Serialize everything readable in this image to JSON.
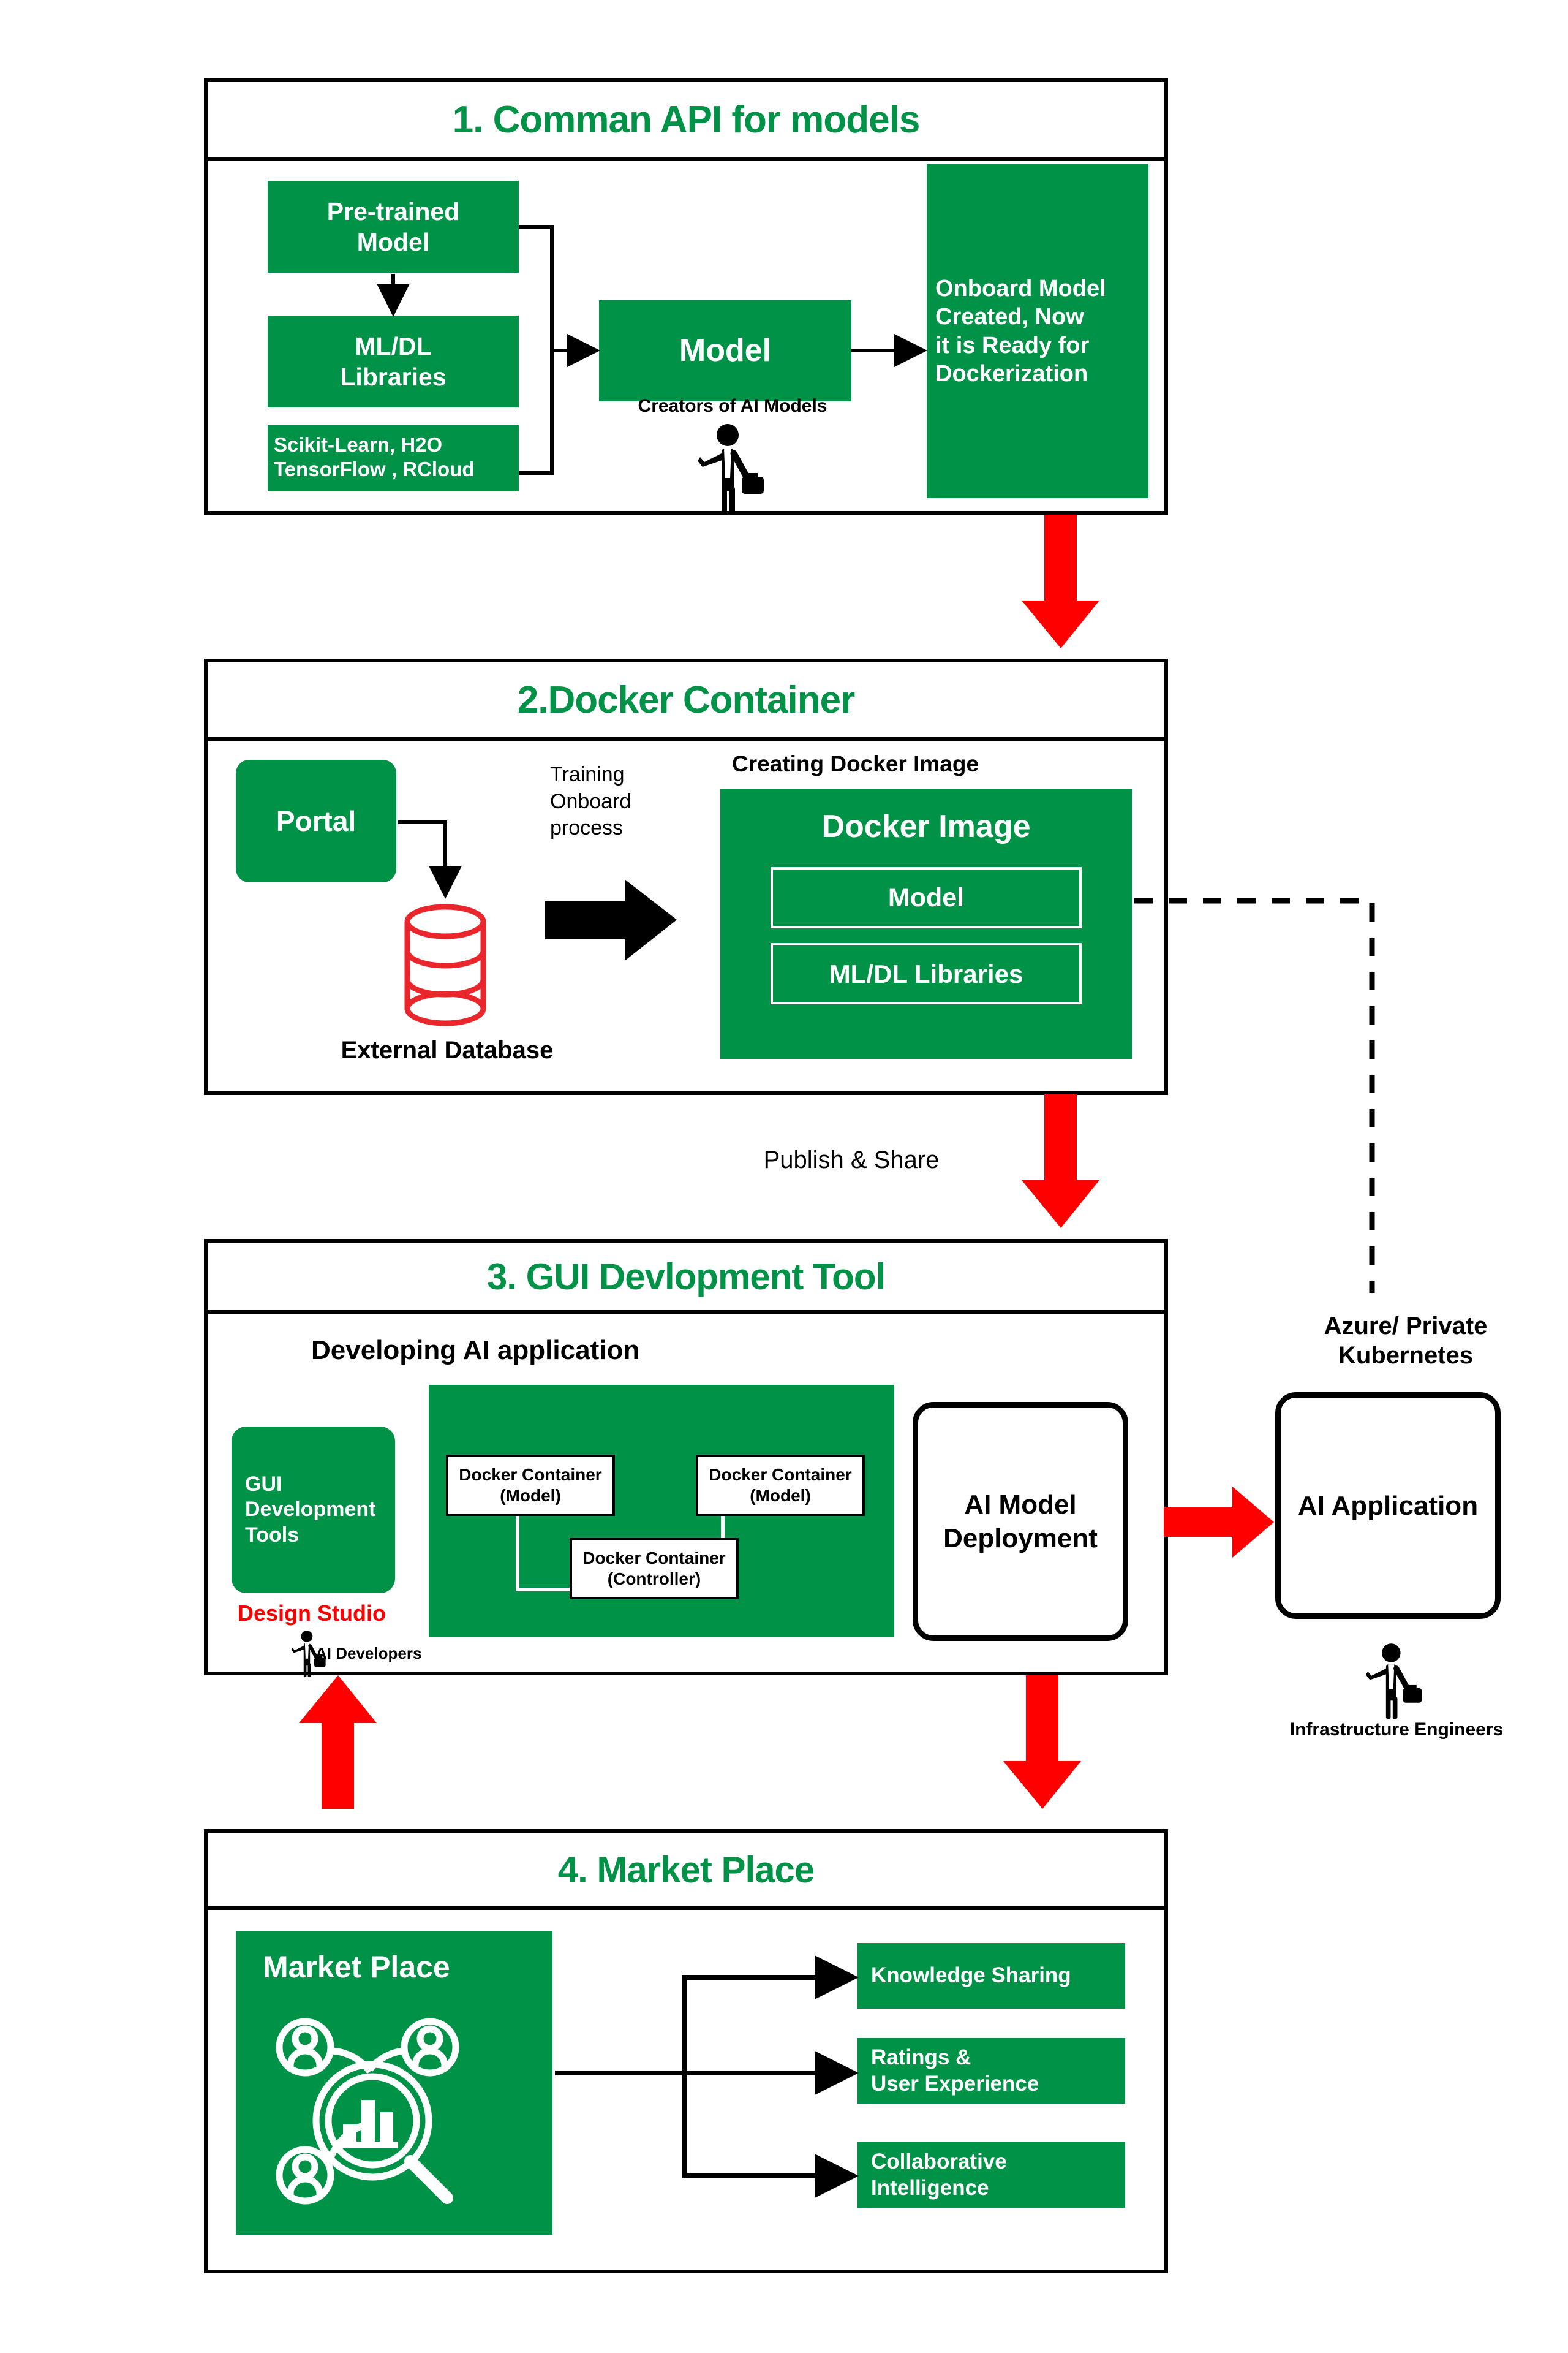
{
  "colors": {
    "green": "#009247",
    "red": "#ff0000",
    "black": "#000000",
    "white": "#ffffff"
  },
  "diagram": {
    "title_color": "#009247",
    "sections": [
      {
        "id": "section-1",
        "title": "1. Comman API for models",
        "boxes": {
          "pretrained_model": "Pre-trained\nModel",
          "pretrained_model_line1": "Pre-trained",
          "pretrained_model_line2": "Model",
          "ml_dl_libraries_line1": "ML/DL",
          "ml_dl_libraries_line2": "Libraries",
          "frameworks_line1": "Scikit-Learn, H2O",
          "frameworks_line2": "TensorFlow  , RCloud",
          "model": "Model",
          "onboard_line1": "Onboard Model",
          "onboard_line2": "Created, Now",
          "onboard_line3": "it is Ready for",
          "onboard_line4": "Dockerization"
        },
        "labels": {
          "creators": "Creators of AI Models"
        }
      },
      {
        "id": "section-2",
        "title": "2.Docker Container",
        "boxes": {
          "portal": "Portal",
          "docker_image": "Docker Image",
          "model": "Model",
          "ml_dl_libraries": "ML/DL Libraries"
        },
        "labels": {
          "training_line1": "Training",
          "training_line2": "Onboard",
          "training_line3": "process",
          "creating_docker_image": "Creating Docker Image",
          "external_database": "External Database"
        }
      },
      {
        "id": "section-3",
        "title": "3. GUI Devlopment Tool",
        "boxes": {
          "gui_dev_tools_line1": "GUI",
          "gui_dev_tools_line2": "Development",
          "gui_dev_tools_line3": "Tools",
          "docker_container_model_a_line1": "Docker Container",
          "docker_container_model_a_line2": "(Model)",
          "docker_container_model_b_line1": "Docker Container",
          "docker_container_model_b_line2": "(Model)",
          "docker_container_controller_line1": "Docker Container",
          "docker_container_controller_line2": "(Controller)",
          "ai_model_deployment_line1": "AI Model",
          "ai_model_deployment_line2": "Deployment"
        },
        "labels": {
          "developing_ai_application": "Developing AI application",
          "design_studio": "Design Studio",
          "ai_developers": "AI Developers"
        }
      },
      {
        "id": "section-4",
        "title": "4. Market Place",
        "boxes": {
          "market_place": "Market Place",
          "knowledge_sharing": "Knowledge Sharing",
          "ratings_line1": "Ratings &",
          "ratings_line2": "User Experience",
          "collaborative_line1": "Collaborative",
          "collaborative_line2": "Intelligence"
        }
      }
    ],
    "flow_labels": {
      "publish_and_share": "Publish & Share"
    },
    "right_column": {
      "azure_line1": "Azure/ Private",
      "azure_line2": "Kubernetes",
      "ai_application": "AI Application",
      "infrastructure_engineers": "Infrastructure Engineers"
    },
    "icons": {
      "person_creators": "businessperson-icon",
      "person_developers": "businessperson-icon",
      "person_infrastructure": "businessperson-icon",
      "database": "database-cylinder-icon",
      "marketplace": "marketplace-network-search-icon",
      "arrow_down_red": "red-down-arrow-icon",
      "arrow_up_red": "red-up-arrow-icon",
      "arrow_right_red": "red-right-arrow-icon",
      "arrow_right_black": "black-right-arrow-icon",
      "dashed_connector": "dashed-connector-line"
    }
  }
}
